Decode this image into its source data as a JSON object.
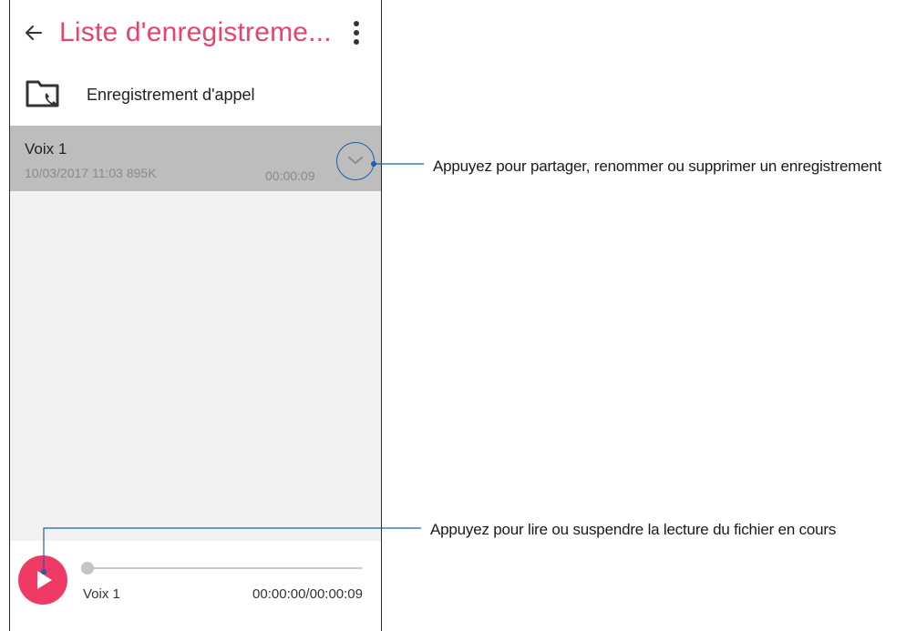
{
  "app": {
    "title": "Liste d'enregistreme...",
    "accent_color": "#e8436d",
    "icons": {
      "back": "arrow-back-icon",
      "menu": "more-vert-icon"
    }
  },
  "folder": {
    "label": "Enregistrement d'appel",
    "icon": "call-recording-folder-icon"
  },
  "recording": {
    "name": "Voix 1",
    "meta": "10/03/2017 11:03  895K",
    "duration": "00:00:09",
    "expand_icon": "chevron-down-icon"
  },
  "player": {
    "track_name": "Voix 1",
    "time": "00:00:00/00:00:09",
    "progress": 0,
    "play_color": "#ef3a66",
    "play_icon": "play-icon"
  },
  "callouts": {
    "expand": "Appuyez pour partager, renommer ou supprimer un enregistrement",
    "play": "Appuyez pour lire ou suspendre la lecture du fichier en cours",
    "line_color": "#1f5fa6"
  }
}
